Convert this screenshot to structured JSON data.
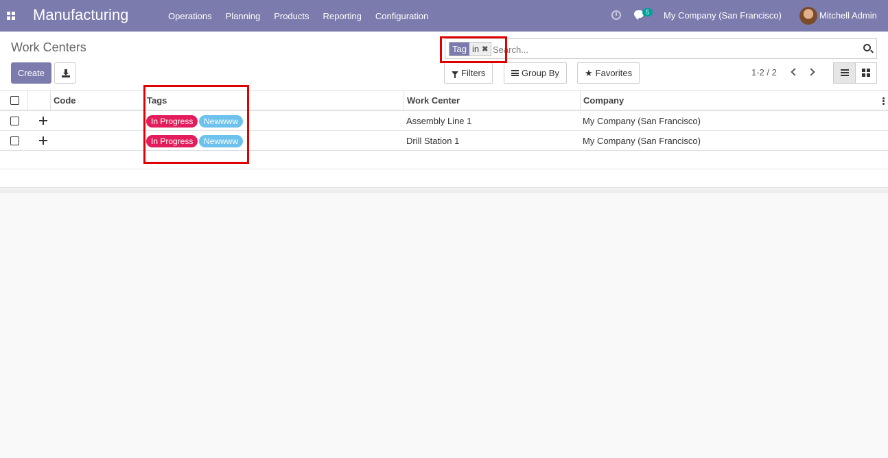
{
  "navbar": {
    "app_name": "Manufacturing",
    "menu": [
      "Operations",
      "Planning",
      "Products",
      "Reporting",
      "Configuration"
    ],
    "chat_count": "5",
    "company": "My Company (San Francisco)",
    "user": "Mitchell Admin"
  },
  "control": {
    "breadcrumb": "Work Centers",
    "create_label": "Create",
    "search": {
      "facet_label": "Tag",
      "facet_value": "in",
      "placeholder": "Search..."
    },
    "filters_label": "Filters",
    "groupby_label": "Group By",
    "favorites_label": "Favorites",
    "pager": "1-2 / 2"
  },
  "table": {
    "columns": [
      "Code",
      "Tags",
      "Work Center",
      "Company"
    ],
    "rows": [
      {
        "code": "",
        "tags": [
          "In Progress",
          "Newwww"
        ],
        "work_center": "Assembly Line 1",
        "company": "My Company (San Francisco)"
      },
      {
        "code": "",
        "tags": [
          "In Progress",
          "Newwww"
        ],
        "work_center": "Drill Station 1",
        "company": "My Company (San Francisco)"
      }
    ]
  },
  "colors": {
    "navbar": "#7c7bad",
    "tag_in_progress": "#e31d5b",
    "tag_newwww": "#6cc1ed",
    "highlight": "#e00000"
  }
}
